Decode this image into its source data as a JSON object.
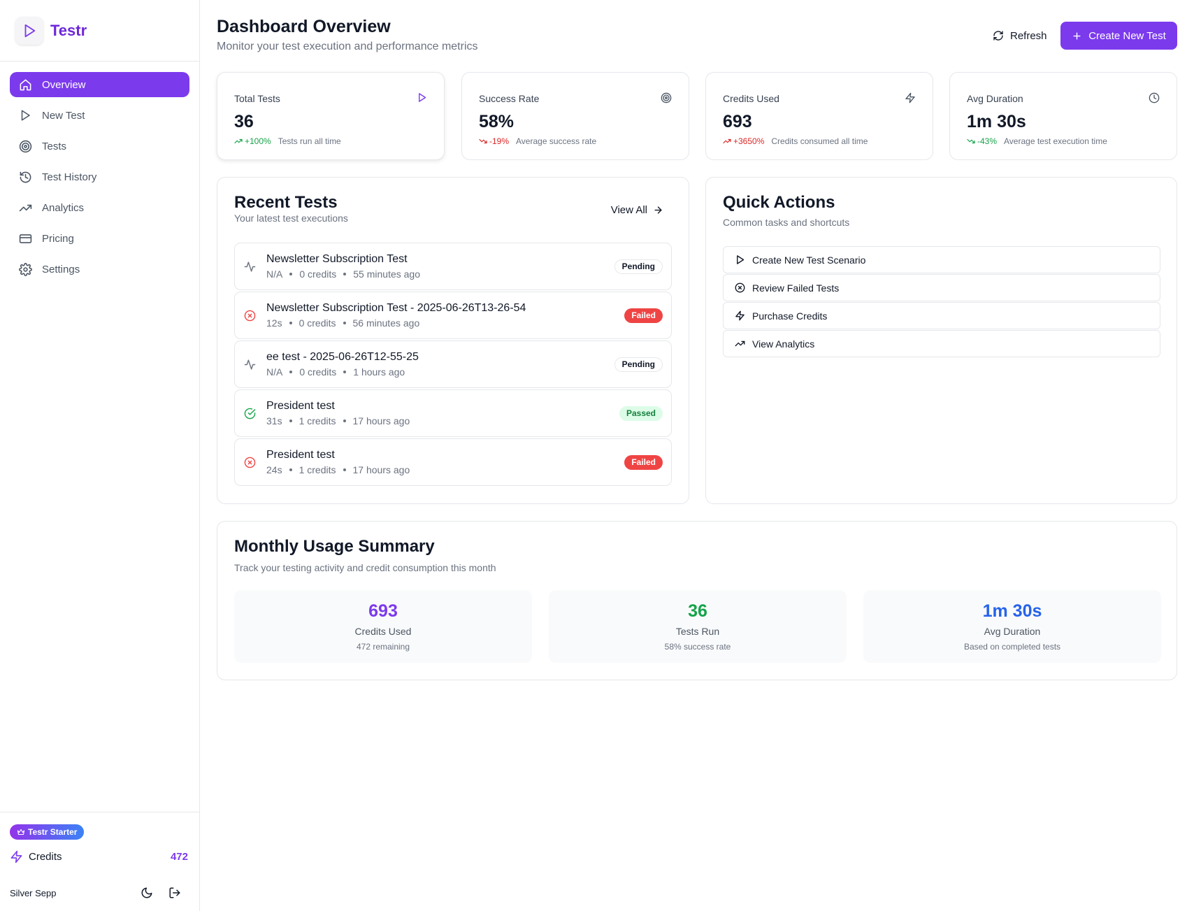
{
  "app": {
    "name": "Testr"
  },
  "sidebar": {
    "items": [
      {
        "label": "Overview",
        "icon": "home-icon",
        "active": true
      },
      {
        "label": "New Test",
        "icon": "play-icon"
      },
      {
        "label": "Tests",
        "icon": "target-icon"
      },
      {
        "label": "Test History",
        "icon": "history-icon"
      },
      {
        "label": "Analytics",
        "icon": "trending-up-icon"
      },
      {
        "label": "Pricing",
        "icon": "credit-card-icon"
      },
      {
        "label": "Settings",
        "icon": "gear-icon"
      }
    ],
    "plan": "Testr Starter",
    "credits_label": "Credits",
    "credits_value": "472",
    "user_name": "Silver Sepp"
  },
  "header": {
    "title": "Dashboard Overview",
    "subtitle": "Monitor your test execution and performance metrics",
    "refresh_label": "Refresh",
    "create_label": "Create New Test"
  },
  "stats": [
    {
      "label": "Total Tests",
      "value": "36",
      "trend": "+100%",
      "trend_dir": "up",
      "note": "Tests run all time",
      "icon": "play-icon"
    },
    {
      "label": "Success Rate",
      "value": "58%",
      "trend": "-19%",
      "trend_dir": "down",
      "note": "Average success rate",
      "icon": "target-icon"
    },
    {
      "label": "Credits Used",
      "value": "693",
      "trend": "+3650%",
      "trend_dir": "down",
      "note": "Credits consumed all time",
      "icon": "zap-icon"
    },
    {
      "label": "Avg Duration",
      "value": "1m 30s",
      "trend": "-43%",
      "trend_dir": "up",
      "note": "Average test execution time",
      "icon": "clock-icon"
    }
  ],
  "recent": {
    "title": "Recent Tests",
    "subtitle": "Your latest test executions",
    "view_all": "View All",
    "tests": [
      {
        "name": "Newsletter Subscription Test",
        "duration": "N/A",
        "credits": "0 credits",
        "time": "55 minutes ago",
        "status": "Pending",
        "icon": "activity-icon"
      },
      {
        "name": "Newsletter Subscription Test - 2025-06-26T13-26-54",
        "duration": "12s",
        "credits": "0 credits",
        "time": "56 minutes ago",
        "status": "Failed",
        "icon": "x-circle-icon"
      },
      {
        "name": "ee test - 2025-06-26T12-55-25",
        "duration": "N/A",
        "credits": "0 credits",
        "time": "1 hours ago",
        "status": "Pending",
        "icon": "activity-icon"
      },
      {
        "name": "President test",
        "duration": "31s",
        "credits": "1 credits",
        "time": "17 hours ago",
        "status": "Passed",
        "icon": "check-circle-icon"
      },
      {
        "name": "President test",
        "duration": "24s",
        "credits": "1 credits",
        "time": "17 hours ago",
        "status": "Failed",
        "icon": "x-circle-icon"
      }
    ]
  },
  "quick_actions": {
    "title": "Quick Actions",
    "subtitle": "Common tasks and shortcuts",
    "items": [
      {
        "label": "Create New Test Scenario",
        "icon": "play-icon"
      },
      {
        "label": "Review Failed Tests",
        "icon": "x-circle-icon"
      },
      {
        "label": "Purchase Credits",
        "icon": "zap-icon"
      },
      {
        "label": "View Analytics",
        "icon": "trending-up-icon"
      }
    ]
  },
  "monthly": {
    "title": "Monthly Usage Summary",
    "subtitle": "Track your testing activity and credit consumption this month",
    "boxes": [
      {
        "value": "693",
        "label": "Credits Used",
        "sub": "472 remaining",
        "color": "#7c3aed"
      },
      {
        "value": "36",
        "label": "Tests Run",
        "sub": "58% success rate",
        "color": "#16a34a"
      },
      {
        "value": "1m 30s",
        "label": "Avg Duration",
        "sub": "Based on completed tests",
        "color": "#2563eb"
      }
    ]
  },
  "colors": {
    "accent": "#7c3aed",
    "success": "#16a34a",
    "danger": "#ef4444",
    "info": "#2563eb"
  }
}
